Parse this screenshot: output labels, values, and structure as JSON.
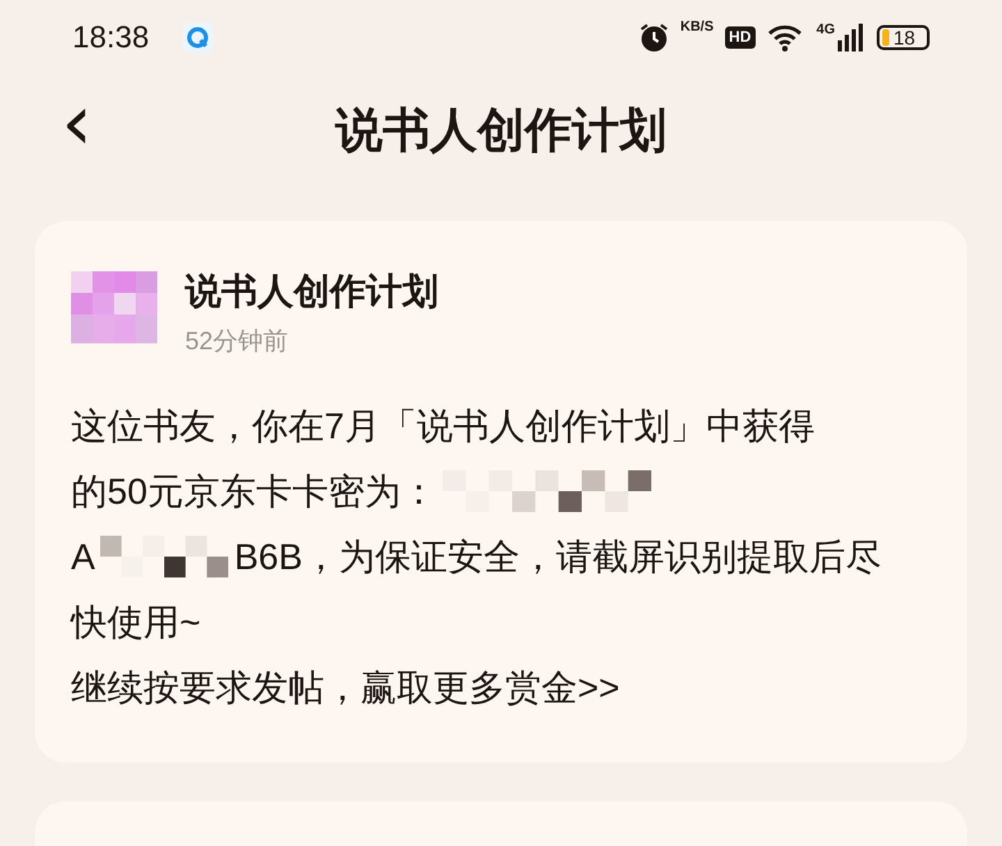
{
  "status_bar": {
    "time": "18:38",
    "speed_unit": "KB/S",
    "hd": "HD",
    "network": "4G",
    "battery": "18"
  },
  "header": {
    "back": "‹",
    "title": "说书人创作计划"
  },
  "message": {
    "sender": "说书人创作计划",
    "time": "52分钟前",
    "lines": [
      [
        {
          "kind": "text",
          "text": "这位书友，你在7月「说书人创作计划」中获得"
        }
      ],
      [
        {
          "kind": "text",
          "text": "的50元京东卡卡密为："
        },
        {
          "kind": "redacted"
        }
      ],
      [
        {
          "kind": "text",
          "text": "A"
        },
        {
          "kind": "redacted"
        },
        {
          "kind": "text",
          "text": "B6B，为保证安全，请截屏识别提取后尽"
        }
      ],
      [
        {
          "kind": "text",
          "text": "快使用~"
        }
      ],
      [
        {
          "kind": "text",
          "text": "继续按要求发帖，赢取更多赏金>>"
        }
      ]
    ]
  }
}
